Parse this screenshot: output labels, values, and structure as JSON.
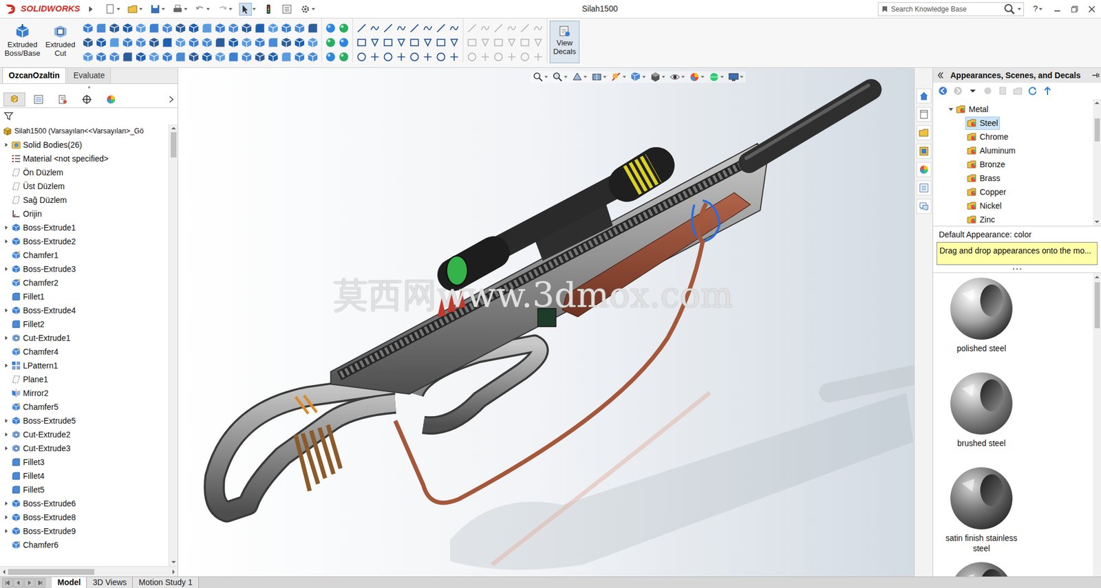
{
  "window": {
    "title": "Silah1500",
    "logo": "SOLIDWORKS",
    "help": "?"
  },
  "search": {
    "placeholder": "Search Knowledge Base"
  },
  "ribbon": {
    "buttons": [
      {
        "label": "Extruded Boss/Base"
      },
      {
        "label": "Extruded Cut"
      }
    ],
    "view_decals": {
      "label": "View Decals",
      "active": true
    }
  },
  "command_tabs": [
    {
      "label": "OzcanOzaltin",
      "selected": true
    },
    {
      "label": "Evaluate",
      "selected": false
    }
  ],
  "tree": {
    "root": "Silah1500  (Varsayılan<<Varsayılan>_Gö",
    "items": [
      {
        "label": "Solid Bodies(26)",
        "expandable": true,
        "kind": "solid-bodies"
      },
      {
        "label": "Material <not specified>",
        "expandable": false,
        "kind": "material"
      },
      {
        "label": "Ön Düzlem",
        "expandable": false,
        "kind": "plane"
      },
      {
        "label": "Üst Düzlem",
        "expandable": false,
        "kind": "plane"
      },
      {
        "label": "Sağ Düzlem",
        "expandable": false,
        "kind": "plane"
      },
      {
        "label": "Orijin",
        "expandable": false,
        "kind": "origin"
      },
      {
        "label": "Boss-Extrude1",
        "expandable": true,
        "kind": "extrude"
      },
      {
        "label": "Boss-Extrude2",
        "expandable": true,
        "kind": "extrude"
      },
      {
        "label": "Chamfer1",
        "expandable": false,
        "kind": "chamfer"
      },
      {
        "label": "Boss-Extrude3",
        "expandable": true,
        "kind": "extrude"
      },
      {
        "label": "Chamfer2",
        "expandable": false,
        "kind": "chamfer"
      },
      {
        "label": "Fillet1",
        "expandable": false,
        "kind": "fillet"
      },
      {
        "label": "Boss-Extrude4",
        "expandable": true,
        "kind": "extrude"
      },
      {
        "label": "Fillet2",
        "expandable": false,
        "kind": "fillet"
      },
      {
        "label": "Cut-Extrude1",
        "expandable": true,
        "kind": "cut"
      },
      {
        "label": "Chamfer4",
        "expandable": false,
        "kind": "chamfer"
      },
      {
        "label": "LPattern1",
        "expandable": true,
        "kind": "pattern"
      },
      {
        "label": "Plane1",
        "expandable": false,
        "kind": "plane"
      },
      {
        "label": "Mirror2",
        "expandable": false,
        "kind": "mirror"
      },
      {
        "label": "Chamfer5",
        "expandable": false,
        "kind": "chamfer"
      },
      {
        "label": "Boss-Extrude5",
        "expandable": true,
        "kind": "extrude"
      },
      {
        "label": "Cut-Extrude2",
        "expandable": true,
        "kind": "cut"
      },
      {
        "label": "Cut-Extrude3",
        "expandable": true,
        "kind": "cut"
      },
      {
        "label": "Fillet3",
        "expandable": false,
        "kind": "fillet"
      },
      {
        "label": "Fillet4",
        "expandable": false,
        "kind": "fillet"
      },
      {
        "label": "Fillet5",
        "expandable": false,
        "kind": "fillet"
      },
      {
        "label": "Boss-Extrude6",
        "expandable": true,
        "kind": "extrude"
      },
      {
        "label": "Boss-Extrude8",
        "expandable": true,
        "kind": "extrude"
      },
      {
        "label": "Boss-Extrude9",
        "expandable": true,
        "kind": "extrude"
      },
      {
        "label": "Chamfer6",
        "expandable": false,
        "kind": "chamfer"
      }
    ]
  },
  "viewport": {
    "watermark": "莫西网www.3dmox.com"
  },
  "task_pane": {
    "title": "Appearances, Scenes, and Decals",
    "folder": {
      "label": "Metal",
      "expanded": true,
      "items": [
        {
          "label": "Steel",
          "selected": true
        },
        {
          "label": "Chrome",
          "selected": false
        },
        {
          "label": "Aluminum",
          "selected": false
        },
        {
          "label": "Bronze",
          "selected": false
        },
        {
          "label": "Brass",
          "selected": false
        },
        {
          "label": "Copper",
          "selected": false
        },
        {
          "label": "Nickel",
          "selected": false
        },
        {
          "label": "Zinc",
          "selected": false
        }
      ]
    },
    "default_appearance": "Default Appearance: color",
    "tip": "Drag and drop appearances onto the mo...",
    "swatches": [
      {
        "label": "polished steel",
        "kind": "polished"
      },
      {
        "label": "brushed steel",
        "kind": "brushed"
      },
      {
        "label": "satin finish stainless steel",
        "kind": "satin"
      },
      {
        "kind": "dark"
      }
    ]
  },
  "bottom_tabs": [
    {
      "label": "Model",
      "selected": true
    },
    {
      "label": "3D Views",
      "selected": false
    },
    {
      "label": "Motion Study 1",
      "selected": false
    }
  ]
}
